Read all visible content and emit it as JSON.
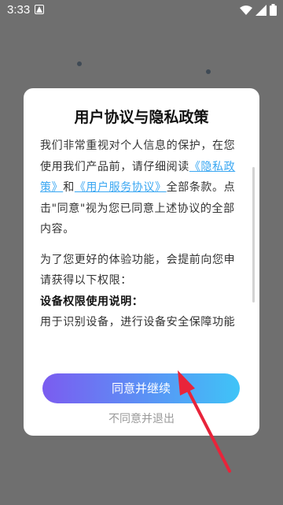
{
  "status_bar": {
    "time": "3:33",
    "icons": [
      "notification-icon",
      "wifi-icon",
      "signal-icon",
      "battery-icon"
    ]
  },
  "dialog": {
    "title": "用户协议与隐私政策",
    "p1_before": "我们非常重视对个人信息的保护，在您使用我们产品前，请仔细阅读",
    "privacy_link": "《隐私政策》",
    "and": "和",
    "service_link": "《用户服务协议》",
    "p1_after": "全部条款。点击\"同意\"视为您已同意上述协议的全部内容。",
    "p2": "为了您更好的体验功能，会提前向您申请获得以下权限：",
    "perm_title": "设备权限使用说明：",
    "perm_text": "用于识别设备，进行设备安全保障功能",
    "agree_button": "同意并继续",
    "disagree_button": "不同意并退出"
  },
  "colors": {
    "link": "#3aa7f2",
    "annotation_arrow": "#e8243a",
    "button_gradient": [
      "#7b5cf0",
      "#3fc4f7"
    ]
  }
}
